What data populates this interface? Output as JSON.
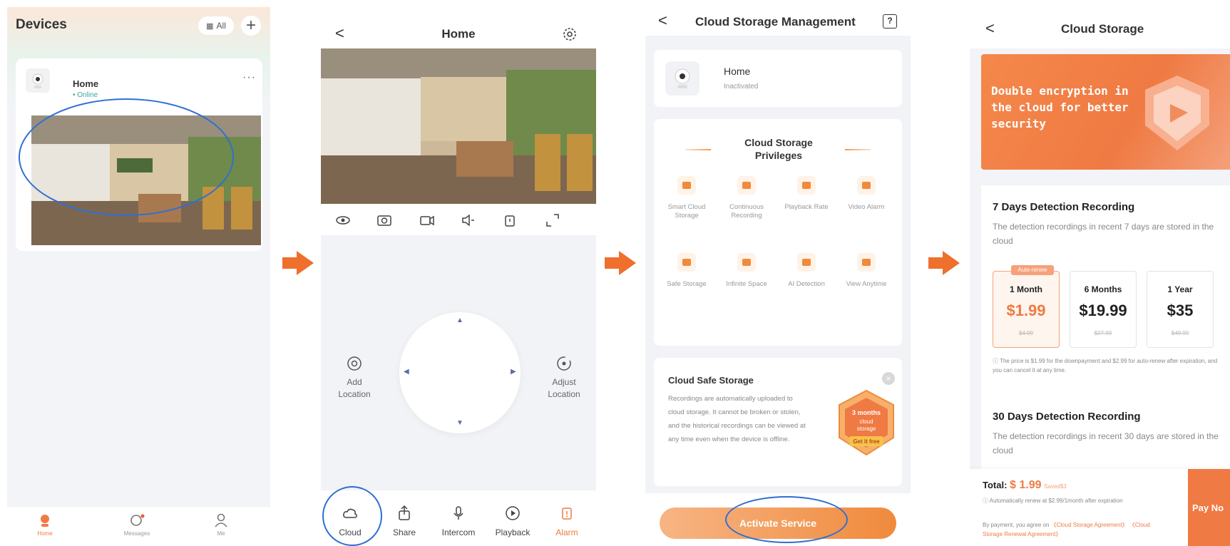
{
  "screen1": {
    "title": "Devices",
    "all_label": "All",
    "add_label": "+",
    "device": {
      "name": "Home",
      "status": "Online"
    },
    "more_label": "···",
    "tabs": [
      {
        "label": "Home",
        "icon": "home-icon"
      },
      {
        "label": "Messages",
        "icon": "messages-icon"
      },
      {
        "label": "Me",
        "icon": "profile-icon"
      }
    ]
  },
  "screen2": {
    "title": "Home",
    "back_label": "<",
    "side_left": "Add\nLocation",
    "side_right": "Adjust\nLocation",
    "bottom": [
      {
        "label": "Cloud",
        "icon": "cloud-icon"
      },
      {
        "label": "Share",
        "icon": "share-icon"
      },
      {
        "label": "Intercom",
        "icon": "microphone-icon"
      },
      {
        "label": "Playback",
        "icon": "playback-icon"
      },
      {
        "label": "Alarm",
        "icon": "alarm-icon"
      }
    ]
  },
  "screen3": {
    "title": "Cloud Storage Management",
    "back_label": "<",
    "help_label": "?",
    "device": {
      "name": "Home",
      "status": "Inactivated"
    },
    "privileges_title": "Cloud Storage Privileges",
    "privileges": [
      "Smart Cloud Storage",
      "Continuous Recording",
      "Playback Rate",
      "Video Alarm",
      "Safe Storage",
      "Infinite Space",
      "AI Detection",
      "View Anytime"
    ],
    "safe_title": "Cloud Safe Storage",
    "safe_text": "Recordings are automatically uploaded to cloud storage. It cannot be broken or stolen, and the historical recordings can be viewed at any time even when the device is offline.",
    "badge_lines": [
      "3 months",
      "cloud",
      "storage"
    ],
    "badge_cta": "Get it free",
    "close_label": "×",
    "activate_label": "Activate Service"
  },
  "screen4": {
    "title": "Cloud Storage",
    "back_label": "<",
    "banner_text": "Double encryption in the cloud for better security",
    "plan7_title": "7 Days Detection Recording",
    "plan7_desc": "The detection recordings in recent 7 days are stored in the cloud",
    "plans": [
      {
        "name": "1 Month",
        "price": "$1.99",
        "original": "$4.99",
        "badge": "Auto-renew"
      },
      {
        "name": "6 Months",
        "price": "$19.99",
        "original": "$27.99"
      },
      {
        "name": "1 Year",
        "price": "$35",
        "original": "$49.99"
      }
    ],
    "price_note": "The price is $1.99 for the downpayment and $2.99 for auto-renew after expiration, and you can cancel it at any time.",
    "plan30_title": "30 Days Detection Recording",
    "plan30_desc": "The detection recordings in recent 30 days are stored in the cloud",
    "total_label": "Total:",
    "total_amount": "$ 1.99",
    "total_saved": "Saved$3",
    "renew_note": "Automatically renew at $2.99/1month after expiration",
    "terms_prefix": "By payment, you agree on",
    "terms_link1": "《Cloud Storage Agreement》",
    "terms_link2": "《Cloud Storage Renewal Agreement》",
    "pay_label": "Pay No"
  },
  "colors": {
    "accent": "#ef7a43",
    "highlight_oval": "#2f6fd3",
    "online": "#3aa7a0"
  }
}
